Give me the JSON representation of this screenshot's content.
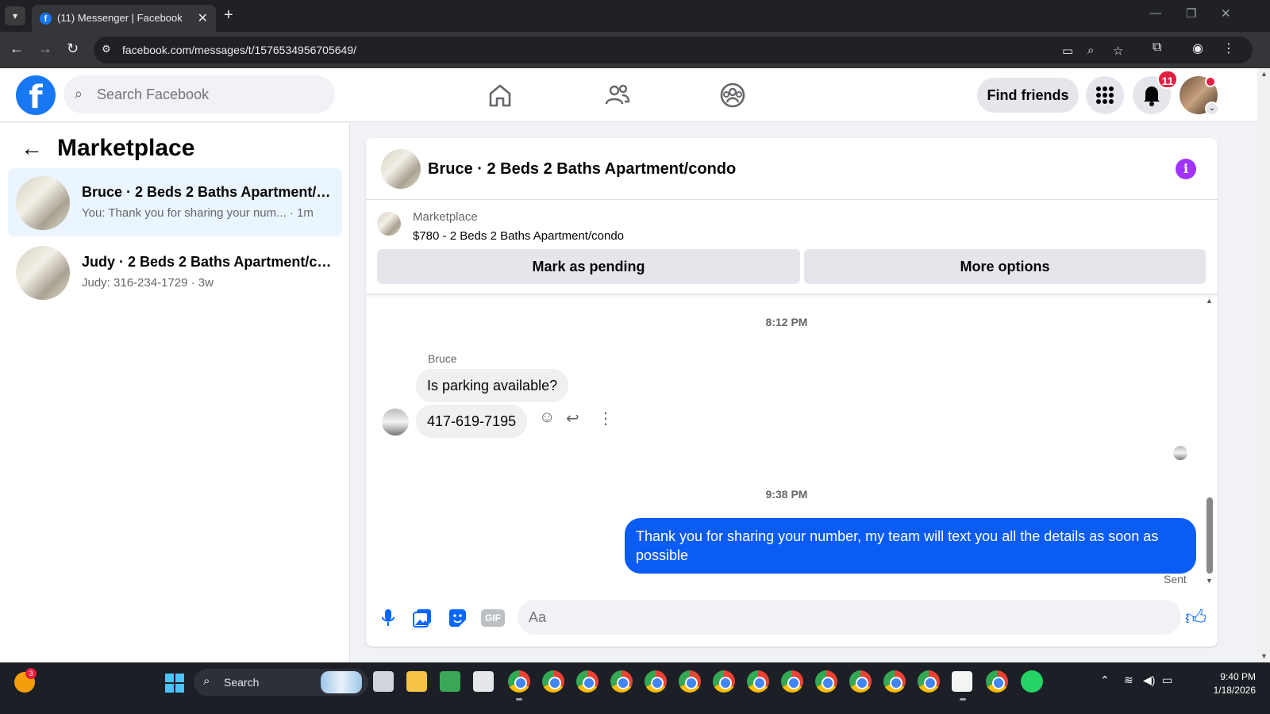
{
  "browser": {
    "tab_title": "(11) Messenger | Facebook",
    "url": "facebook.com/messages/t/1576534956705649/"
  },
  "header": {
    "search_placeholder": "Search Facebook",
    "find_friends": "Find friends",
    "notification_count": "11"
  },
  "sidebar": {
    "title": "Marketplace",
    "conversations": [
      {
        "name": "Bruce · 2 Beds 2 Baths Apartment/condo",
        "preview": "You: Thank you for sharing your num...",
        "time": "· 1m",
        "active": true
      },
      {
        "name": "Judy · 2 Beds 2 Baths Apartment/condo",
        "preview": "Judy: 316-234-1729",
        "time": "· 3w",
        "active": false
      }
    ]
  },
  "chat": {
    "title": "Bruce · 2 Beds 2 Baths Apartment/condo",
    "listing": {
      "source": "Marketplace",
      "price_title": "$780 - 2 Beds 2 Baths Apartment/condo",
      "mark_pending": "Mark as pending",
      "more_options": "More options"
    },
    "messages": {
      "timestamp_1": "8:12 PM",
      "sender": "Bruce",
      "incoming_1": "Is parking available?",
      "incoming_2": "417-619-7195",
      "timestamp_2": "9:38 PM",
      "outgoing_1": "Thank you for  sharing your number, my team will text you all the details as soon as possible",
      "status": "Sent"
    },
    "composer": {
      "placeholder": "Aa"
    }
  },
  "taskbar": {
    "search_label": "Search",
    "weather_badge": "3",
    "time": "9:40 PM",
    "date": "1/18/2026"
  }
}
